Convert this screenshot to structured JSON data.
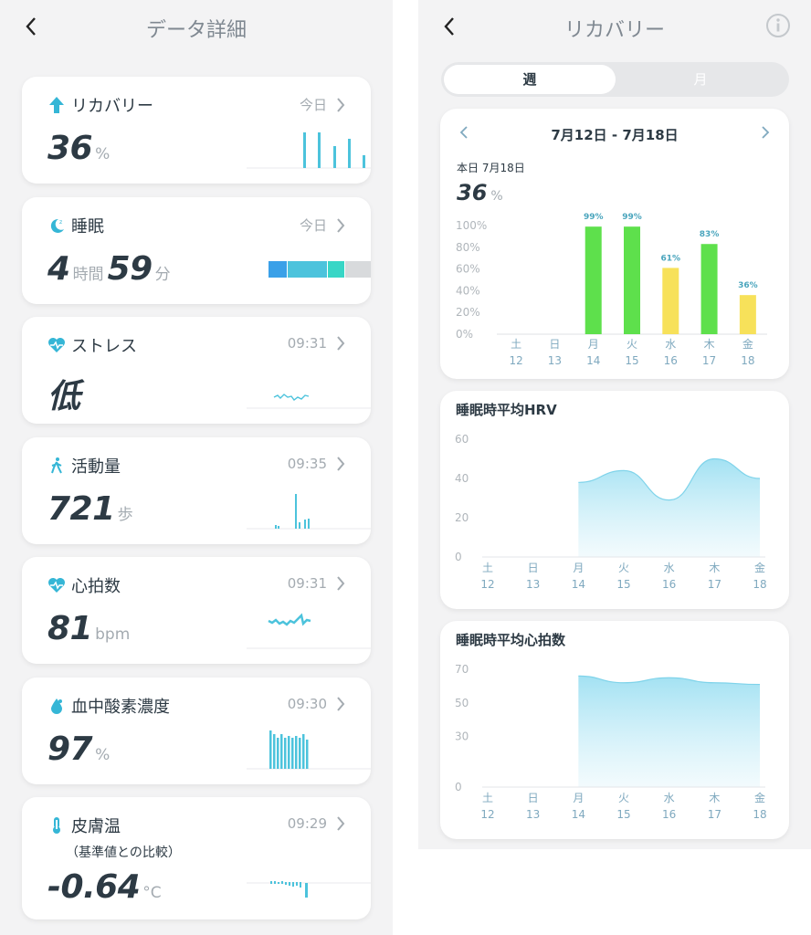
{
  "left": {
    "title": "データ詳細",
    "cards": [
      {
        "title": "リカバリー",
        "meta": "今日",
        "value": "36",
        "unit": "%",
        "icon": "arrow-up-icon"
      },
      {
        "title": "睡眠",
        "meta": "今日",
        "value1": "4",
        "unit1": "時間",
        "value2": "59",
        "unit2": "分",
        "icon": "moon-icon"
      },
      {
        "title": "ストレス",
        "meta": "09:31",
        "value": "低",
        "icon": "heart-pulse-icon"
      },
      {
        "title": "活動量",
        "meta": "09:35",
        "value": "721",
        "unit": "歩",
        "icon": "walk-icon"
      },
      {
        "title": "心拍数",
        "meta": "09:31",
        "value": "81",
        "unit": "bpm",
        "icon": "heart-pulse-icon"
      },
      {
        "title": "血中酸素濃度",
        "meta": "09:30",
        "value": "97",
        "unit": "%",
        "icon": "drop-icon"
      },
      {
        "title": "皮膚温",
        "subtitle": "（基準値との比較）",
        "meta": "09:29",
        "value": "-0.64",
        "unit": "°C",
        "icon": "thermometer-icon"
      }
    ]
  },
  "right": {
    "title": "リカバリー",
    "tabs": [
      "週",
      "月"
    ],
    "range": "7月12日 - 7月18日",
    "today_label": "本日 7月18日",
    "today_value": "36",
    "today_unit": "%",
    "hrv_title": "睡眠時平均HRV",
    "hr_title": "睡眠時平均心拍数"
  },
  "colors": {
    "accent": "#4cc3dc",
    "green": "#5ee04c",
    "yellow": "#f7e15a",
    "text": "#2d3a44",
    "muted": "#a4abb1"
  },
  "chart_data": [
    {
      "type": "bar",
      "categories": [
        "土 12",
        "日 13",
        "月 14",
        "火 15",
        "水 16",
        "木 17",
        "金 18"
      ],
      "day": [
        "土",
        "日",
        "月",
        "火",
        "水",
        "木",
        "金"
      ],
      "date": [
        "12",
        "13",
        "14",
        "15",
        "16",
        "17",
        "18"
      ],
      "values": [
        null,
        null,
        99,
        99,
        61,
        83,
        36
      ],
      "labels": [
        "",
        "",
        "99%",
        "99%",
        "61%",
        "83%",
        "36%"
      ],
      "bar_colors": [
        "#5ee04c",
        "#5ee04c",
        "#5ee04c",
        "#5ee04c",
        "#f7e15a",
        "#5ee04c",
        "#f7e15a"
      ],
      "yticks": [
        "0%",
        "20%",
        "40%",
        "60%",
        "80%",
        "100%"
      ],
      "ylim": [
        0,
        100
      ]
    },
    {
      "type": "area",
      "title": "睡眠時平均HRV",
      "day": [
        "土",
        "日",
        "月",
        "火",
        "水",
        "木",
        "金"
      ],
      "date": [
        "12",
        "13",
        "14",
        "15",
        "16",
        "17",
        "18"
      ],
      "values": [
        null,
        null,
        38,
        44,
        29,
        50,
        40
      ],
      "yticks": [
        "0",
        "20",
        "40",
        "60"
      ],
      "ylim": [
        0,
        60
      ]
    },
    {
      "type": "area",
      "title": "睡眠時平均心拍数",
      "day": [
        "土",
        "日",
        "月",
        "火",
        "水",
        "木",
        "金"
      ],
      "date": [
        "12",
        "13",
        "14",
        "15",
        "16",
        "17",
        "18"
      ],
      "values": [
        null,
        null,
        66,
        62,
        65,
        62,
        61
      ],
      "yticks": [
        "0",
        "30",
        "50",
        "70"
      ],
      "ytick_values": [
        0,
        30,
        50,
        70
      ],
      "ylim": [
        0,
        70
      ]
    }
  ]
}
